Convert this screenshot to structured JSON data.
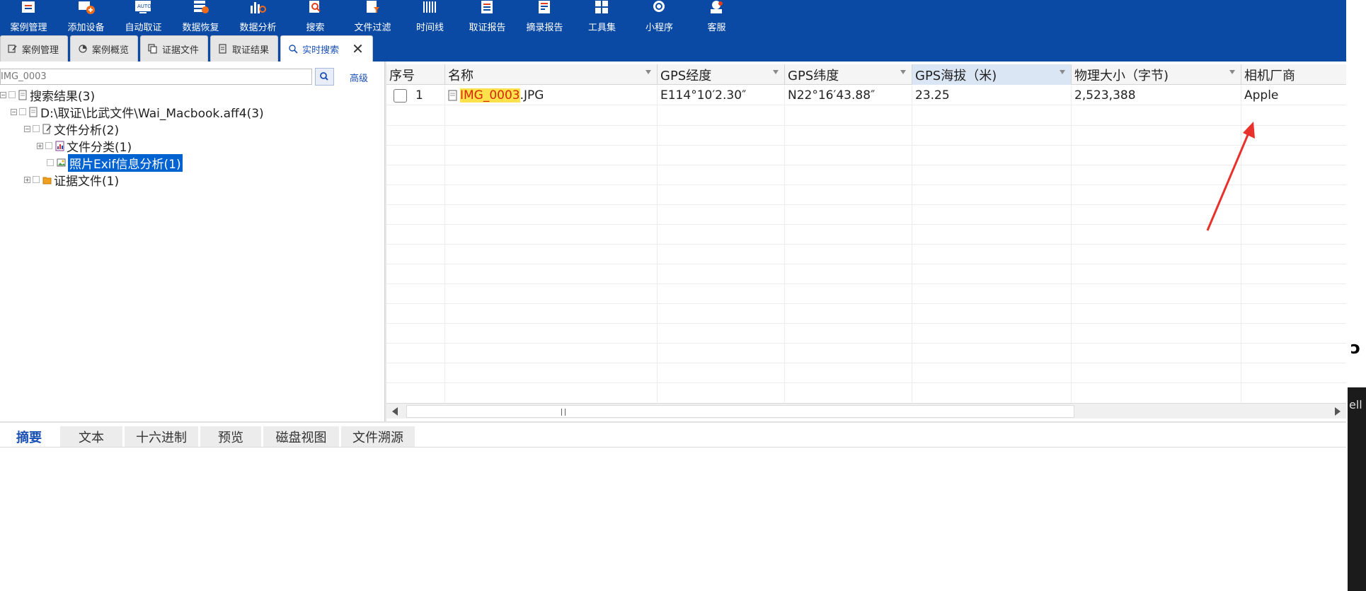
{
  "toolbar": [
    {
      "label": "案例管理",
      "icon": "case-manage-icon"
    },
    {
      "label": "添加设备",
      "icon": "add-device-icon"
    },
    {
      "label": "自动取证",
      "icon": "auto-forensics-icon"
    },
    {
      "label": "数据恢复",
      "icon": "data-recovery-icon"
    },
    {
      "label": "数据分析",
      "icon": "data-analysis-icon"
    },
    {
      "label": "搜索",
      "icon": "search-tool-icon"
    },
    {
      "label": "文件过滤",
      "icon": "file-filter-icon"
    },
    {
      "label": "时间线",
      "icon": "timeline-icon"
    },
    {
      "label": "取证报告",
      "icon": "forensic-report-icon"
    },
    {
      "label": "摘录报告",
      "icon": "excerpt-report-icon"
    },
    {
      "label": "工具集",
      "icon": "toolkit-icon"
    },
    {
      "label": "小程序",
      "icon": "mini-program-icon"
    },
    {
      "label": "客服",
      "icon": "customer-service-icon"
    }
  ],
  "tabs": [
    {
      "label": "案例管理"
    },
    {
      "label": "案例概览"
    },
    {
      "label": "证据文件"
    },
    {
      "label": "取证结果"
    },
    {
      "label": "实时搜索"
    }
  ],
  "search": {
    "value": "IMG_0003",
    "advanced_label": "高级"
  },
  "tree": {
    "root": "搜索结果(3)",
    "evidence_path": "D:\\取证\\比武文件\\Wai_Macbook.aff4(3)",
    "file_analysis": "文件分析(2)",
    "file_category": "文件分类(1)",
    "exif_analysis": "照片Exif信息分析(1)",
    "evidence_files": "证据文件(1)"
  },
  "grid": {
    "columns": [
      "序号",
      "名称",
      "GPS经度",
      "GPS纬度",
      "GPS海拔（米)",
      "物理大小（字节)",
      "相机厂商"
    ],
    "rows": [
      {
        "index": "1",
        "name_highlight": "IMG_0003",
        "name_rest": ".JPG",
        "lon": "E114°10′2.30″",
        "lat": "N22°16′43.88″",
        "alt": "23.25",
        "size": "2,523,388",
        "vendor": "Apple"
      }
    ]
  },
  "bottom_tabs": [
    "摘要",
    "文本",
    "十六进制",
    "预览",
    "磁盘视图",
    "文件溯源"
  ],
  "colors": {
    "ribbon": "#0a4aa4",
    "accent": "#1a4fb4",
    "highlight": "#ffe14b",
    "annotation_arrow": "#e8312b"
  }
}
